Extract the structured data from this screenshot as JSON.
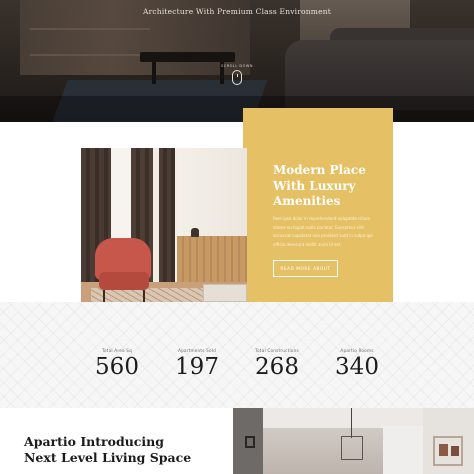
{
  "hero": {
    "subtitle": "Architecture With Premium Class Environment",
    "scroll_label": "SCROLL DOWN"
  },
  "feature": {
    "title": "Modern Place With Luxury Amenities",
    "body": "Rem ipsa dolor in reprehenderit voluptate cillum dolore eu fugiat nulla pariatur. Excepteur sint occaecat cupidatat non proident sunt in culpa qui officia deserunt mollit anim id est.",
    "button_label": "READ MORE ABOUT",
    "accent_color": "#e6c064"
  },
  "stats": [
    {
      "label": "Total Area Sq",
      "value": "560"
    },
    {
      "label": "Apartments Sold",
      "value": "197"
    },
    {
      "label": "Total Constructions",
      "value": "268"
    },
    {
      "label": "Apartio Rooms",
      "value": "340"
    }
  ],
  "bottom": {
    "title_line1": "Apartio Introducing",
    "title_line2": "Next Level Living Space"
  }
}
